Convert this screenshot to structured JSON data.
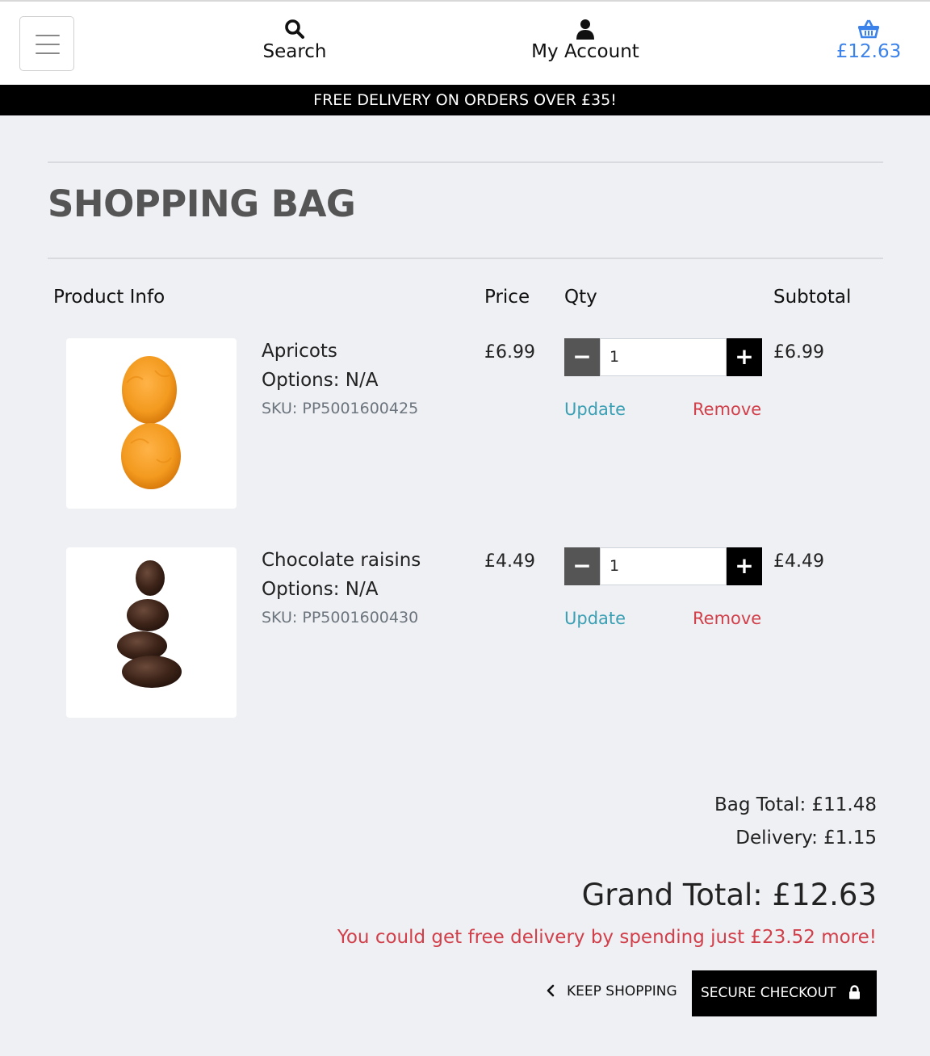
{
  "header": {
    "search_label": "Search",
    "account_label": "My Account",
    "bag_total": "£12.63",
    "accent_color": "#3b82ea"
  },
  "banner": {
    "text": "FREE DELIVERY ON ORDERS OVER £35!"
  },
  "page": {
    "title": "SHOPPING BAG"
  },
  "table": {
    "headers": {
      "product_info": "Product Info",
      "price": "Price",
      "qty": "Qty",
      "subtotal": "Subtotal"
    }
  },
  "items": [
    {
      "name": "Apricots",
      "options": "Options: N/A",
      "sku": "SKU: PP5001600425",
      "price": "£6.99",
      "qty": "1",
      "subtotal": "£6.99",
      "update_label": "Update",
      "remove_label": "Remove",
      "image": "dried-apricots"
    },
    {
      "name": "Chocolate raisins",
      "options": "Options: N/A",
      "sku": "SKU: PP5001600430",
      "price": "£4.49",
      "qty": "1",
      "subtotal": "£4.49",
      "update_label": "Update",
      "remove_label": "Remove",
      "image": "chocolate-raisins"
    }
  ],
  "totals": {
    "bag_total": "Bag Total: £11.48",
    "delivery": "Delivery: £1.15",
    "grand_total": "Grand Total: £12.63",
    "free_delivery_msg": "You could get free delivery by spending just £23.52 more!"
  },
  "actions": {
    "keep_shopping": "KEEP SHOPPING",
    "secure_checkout": "SECURE CHECKOUT"
  },
  "icons": {
    "menu": "hamburger-icon",
    "search": "search-icon",
    "account": "user-icon",
    "bag": "basket-icon",
    "back": "chevron-left-icon",
    "lock": "lock-icon"
  }
}
